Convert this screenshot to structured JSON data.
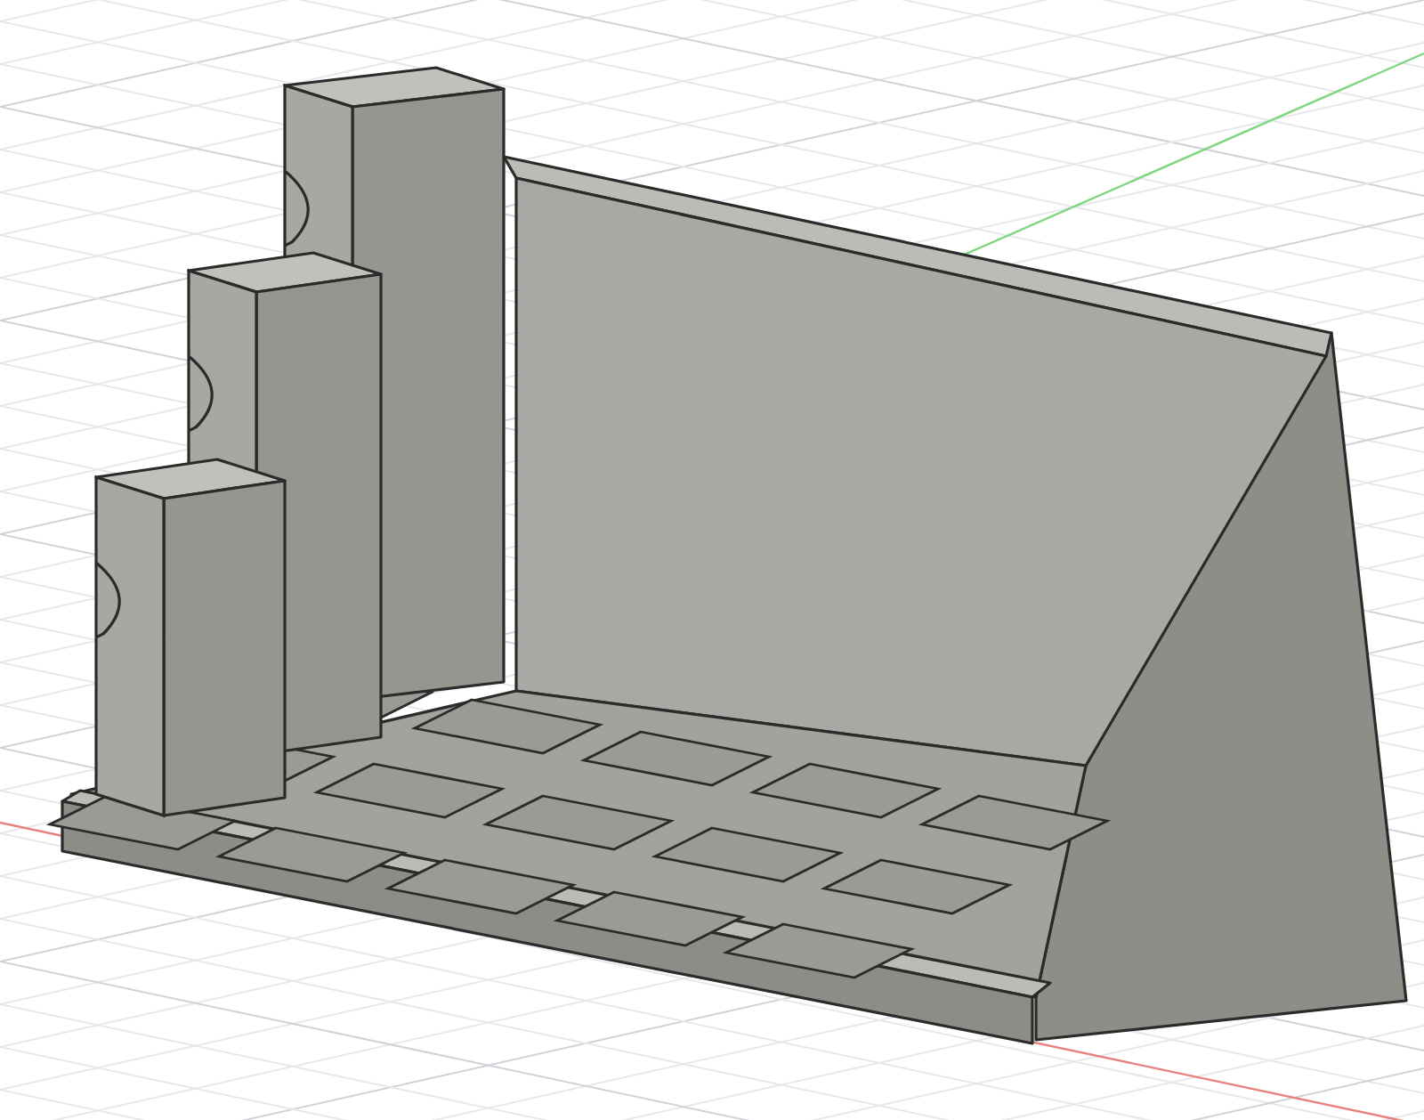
{
  "viewport": {
    "kind": "cad-model"
  }
}
